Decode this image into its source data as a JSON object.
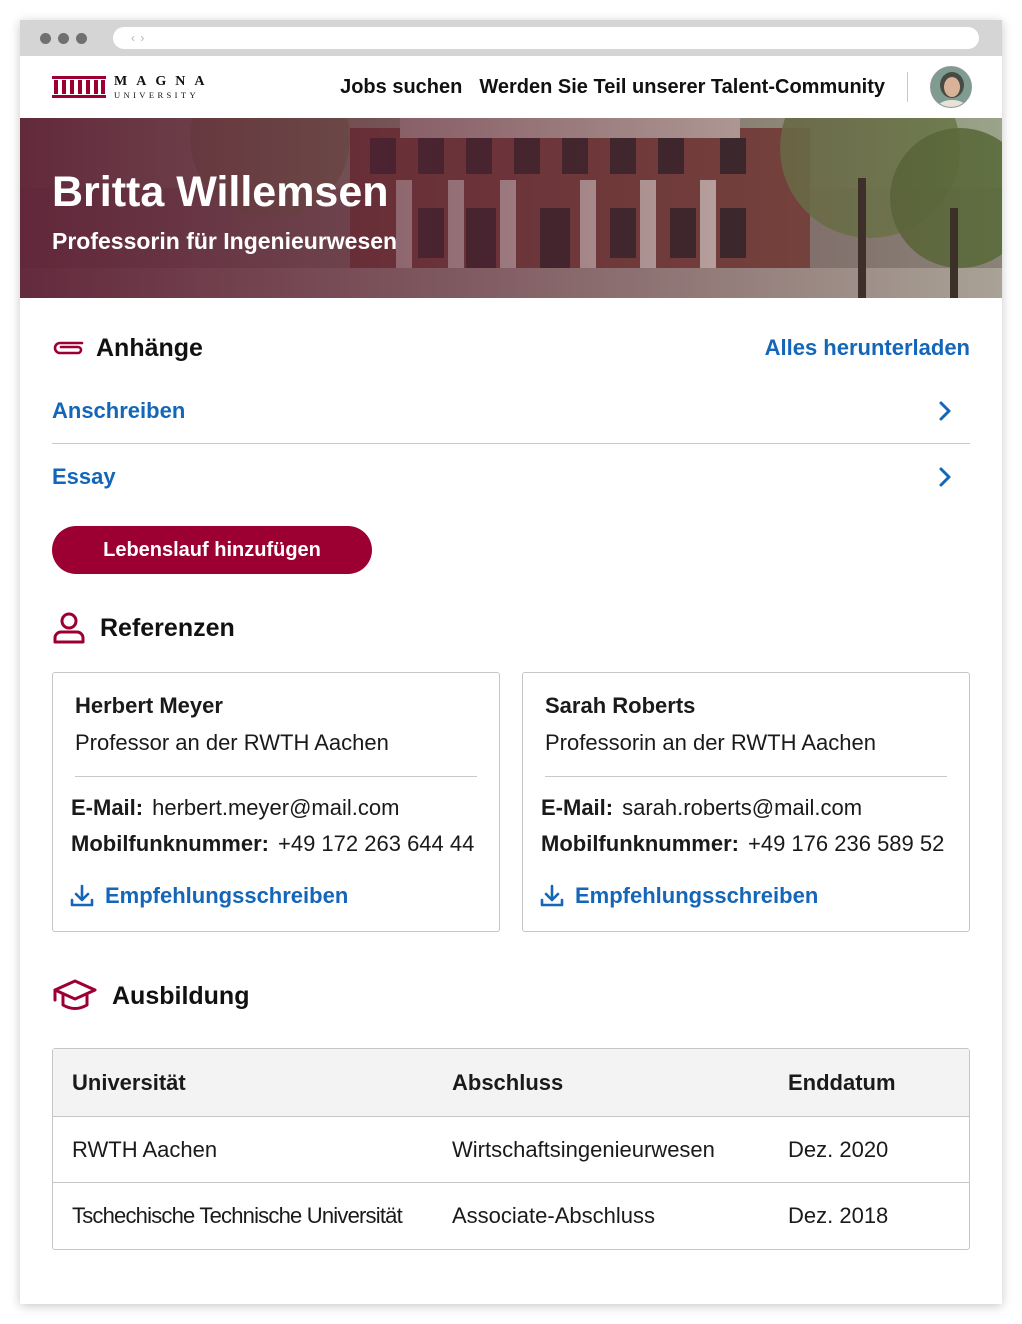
{
  "browser": {
    "nav_arrows": "‹ ›"
  },
  "header": {
    "logo": {
      "name": "MAGNA",
      "sub": "UNIVERSITY"
    },
    "nav": [
      "Jobs suchen",
      "Werden Sie Teil unserer Talent-Community"
    ],
    "avatar_icon": "user-avatar-photo"
  },
  "profile": {
    "name": "Britta Willemsen",
    "title": "Professorin für Ingenieurwesen"
  },
  "attachments": {
    "title": "Anhänge",
    "download_all": "Alles herunterladen",
    "items": [
      {
        "label": "Anschreiben"
      },
      {
        "label": "Essay"
      }
    ],
    "add_cv_button": "Lebenslauf hinzufügen"
  },
  "references": {
    "title": "Referenzen",
    "email_label": "E-Mail:",
    "mobile_label": "Mobilfunknummer:",
    "letter_label": "Empfehlungsschreiben",
    "people": [
      {
        "name": "Herbert Meyer",
        "role": "Professor an der RWTH Aachen",
        "email": "herbert.meyer@mail.com",
        "mobile": "+49 172 263 644 44"
      },
      {
        "name": "Sarah Roberts",
        "role": "Professorin an der RWTH Aachen",
        "email": "sarah.roberts@mail.com",
        "mobile": "+49 176 236 589 52"
      }
    ]
  },
  "education": {
    "title": "Ausbildung",
    "columns": [
      "Universität",
      "Abschluss",
      "Enddatum"
    ],
    "rows": [
      [
        "RWTH Aachen",
        "Wirtschaftsingenieurwesen",
        "Dez. 2020"
      ],
      [
        "Tschechische Technische Universität",
        "Associate-Abschluss",
        "Dez. 2018"
      ]
    ]
  },
  "colors": {
    "brand": "#9c0032",
    "link": "#1466b8",
    "chrome": "#d5d5d5"
  }
}
